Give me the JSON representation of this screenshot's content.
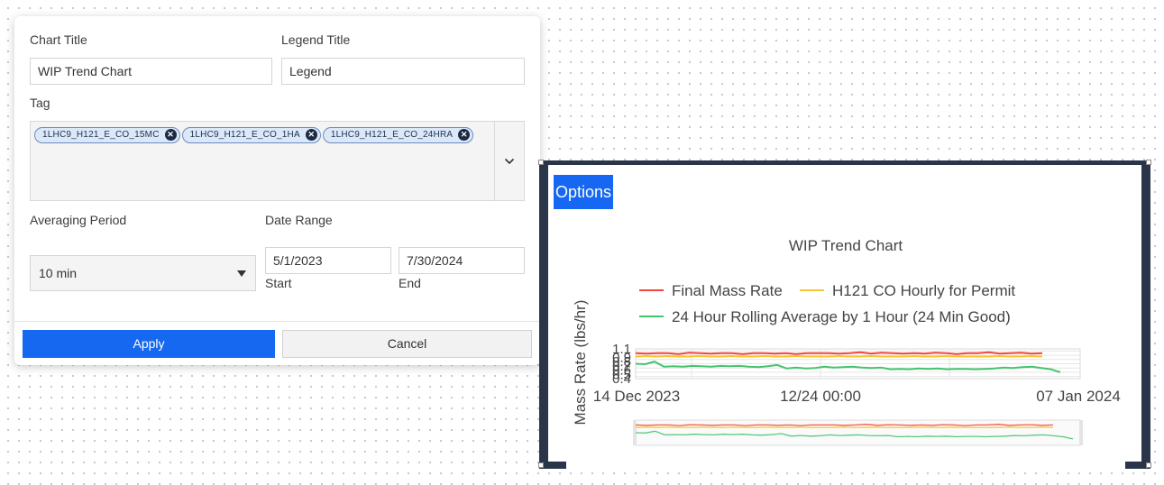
{
  "form": {
    "chart_title_label": "Chart Title",
    "chart_title_value": "WIP Trend Chart",
    "legend_title_label": "Legend Title",
    "legend_title_value": "Legend",
    "tag_label": "Tag",
    "tags": [
      "1LHC9_H121_E_CO_15MC",
      "1LHC9_H121_E_CO_1HA",
      "1LHC9_H121_E_CO_24HRA"
    ],
    "averaging_label": "Averaging Period",
    "averaging_value": "10 min",
    "date_range_label": "Date Range",
    "start_value": "5/1/2023",
    "start_label": "Start",
    "end_value": "7/30/2024",
    "end_label": "End",
    "apply_label": "Apply",
    "cancel_label": "Cancel"
  },
  "widget": {
    "options_label": "Options"
  },
  "chart_data": {
    "type": "line",
    "title": "WIP Trend Chart",
    "ylabel": "Mass Rate (lbs/hr)",
    "xlabel": "",
    "x_ticks": [
      "14 Dec 2023",
      "12/24 00:00",
      "07 Jan 2024"
    ],
    "y_ticks": [
      "1.1",
      "0.9",
      "0.8",
      "0.7",
      "0.6",
      "0.5",
      "0.4"
    ],
    "ylim": [
      0.4,
      1.1
    ],
    "legend_position": "top",
    "series": [
      {
        "name": "Final Mass Rate",
        "color": "#f2463d",
        "values": [
          1.0,
          0.99,
          1.0,
          1.0,
          0.98,
          1.01,
          1.0,
          0.99,
          1.0,
          1.0,
          0.98,
          1.0,
          1.0,
          0.99,
          1.0,
          0.98,
          1.0,
          1.0,
          1.0,
          0.99,
          1.0,
          1.02,
          0.99,
          1.01,
          1.0,
          0.99,
          1.0,
          0.99,
          1.01,
          1.0,
          0.98,
          1.0,
          1.0,
          1.02,
          0.99,
          1.0,
          1.01,
          0.99,
          1.0
        ]
      },
      {
        "name": "H121 CO Hourly for Permit",
        "color": "#f6c52f",
        "values": [
          0.92,
          0.93,
          0.92,
          0.93,
          0.92,
          0.92,
          0.93,
          0.92,
          0.92,
          0.93,
          0.92,
          0.92,
          0.93,
          0.92,
          0.92,
          0.93,
          0.92,
          0.92,
          0.92,
          0.93,
          0.92,
          0.92,
          0.93,
          0.92,
          0.92,
          0.92,
          0.93,
          0.92,
          0.92,
          0.93,
          0.92,
          0.92,
          0.92,
          0.92,
          0.93,
          0.92,
          0.92,
          0.93,
          0.92
        ]
      },
      {
        "name": "24 Hour Rolling Average by 1 Hour (24 Min Good)",
        "color": "#45c46e",
        "values": [
          0.75,
          0.74,
          0.8,
          0.68,
          0.69,
          0.68,
          0.7,
          0.69,
          0.68,
          0.7,
          0.69,
          0.7,
          0.68,
          0.67,
          0.69,
          0.72,
          0.64,
          0.66,
          0.64,
          0.65,
          0.68,
          0.66,
          0.67,
          0.68,
          0.66,
          0.65,
          0.66,
          0.62,
          0.63,
          0.62,
          0.64,
          0.63,
          0.64,
          0.62,
          0.63,
          0.63,
          0.62,
          0.63,
          0.64,
          0.66,
          0.65,
          0.67,
          0.68,
          0.65,
          0.62,
          0.55
        ]
      }
    ]
  }
}
